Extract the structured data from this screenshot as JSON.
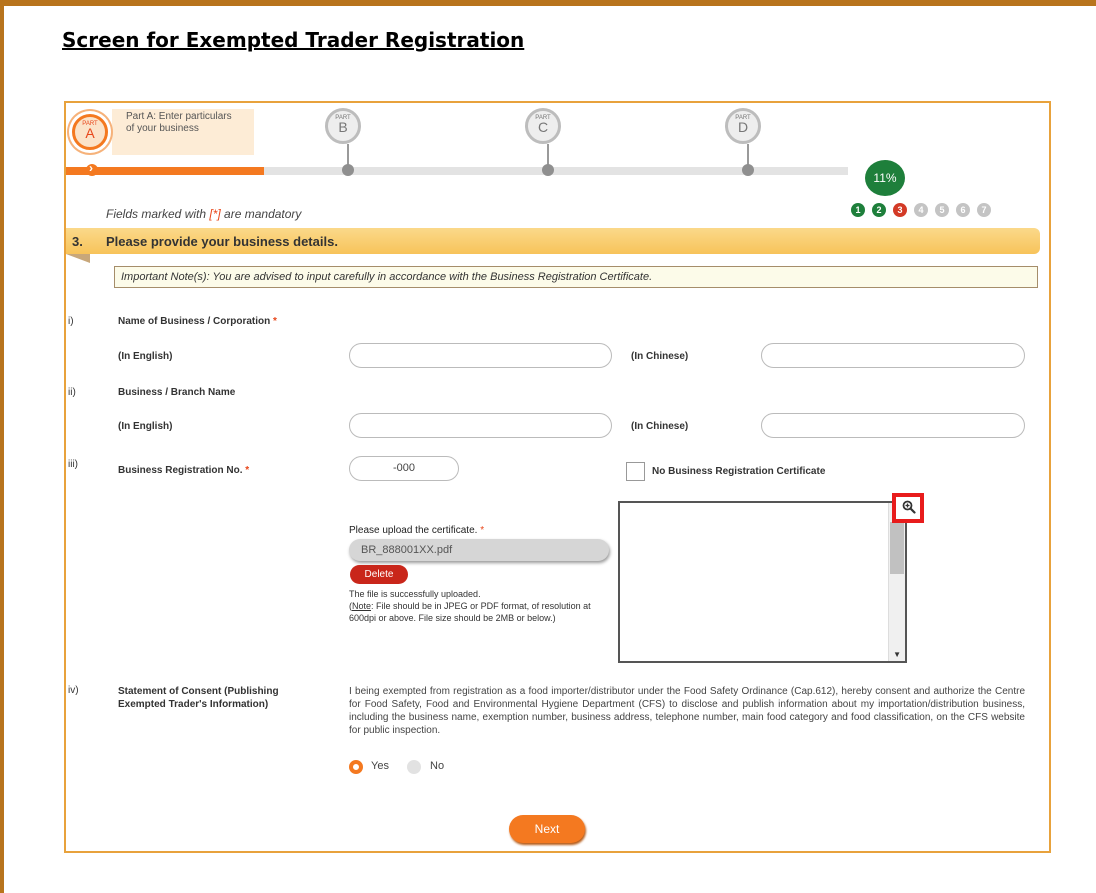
{
  "document_title": "Screen for Exempted Trader Registration",
  "progress": {
    "parts": [
      {
        "small": "PART",
        "letter": "A",
        "active": true
      },
      {
        "small": "PART",
        "letter": "B",
        "active": false
      },
      {
        "small": "PART",
        "letter": "C",
        "active": false
      },
      {
        "small": "PART",
        "letter": "D",
        "active": false
      }
    ],
    "active_part_description": "Part A: Enter particulars of your business",
    "percent_label": "11%",
    "percent_value": 0.11,
    "steps": [
      {
        "label": "1",
        "state": "done"
      },
      {
        "label": "2",
        "state": "done"
      },
      {
        "label": "3",
        "state": "current"
      },
      {
        "label": "4",
        "state": "pending"
      },
      {
        "label": "5",
        "state": "pending"
      },
      {
        "label": "6",
        "state": "pending"
      },
      {
        "label": "7",
        "state": "pending"
      }
    ]
  },
  "mandatory_note": {
    "prefix": "Fields marked with ",
    "star": "[*]",
    "suffix": " are mandatory"
  },
  "section": {
    "number": "3.",
    "title": "Please provide your business details."
  },
  "important_note": "Important Note(s): You are advised to input carefully in accordance with the Business Registration Certificate.",
  "questions": {
    "q1": {
      "roman": "i)",
      "label": "Name of Business / Corporation",
      "required_mark": "*",
      "english_label": "(In English)",
      "english_value": "",
      "chinese_label": "(In Chinese)",
      "chinese_value": ""
    },
    "q2": {
      "roman": "ii)",
      "label": "Business / Branch Name",
      "english_label": "(In English)",
      "english_value": "",
      "chinese_label": "(In Chinese)",
      "chinese_value": ""
    },
    "q3": {
      "roman": "iii)",
      "label": "Business Registration No.",
      "required_mark": "*",
      "br_value": "-000",
      "no_brc_label": "No Business Registration Certificate",
      "no_brc_checked": false
    },
    "upload": {
      "title": "Please upload the certificate.",
      "required_mark": "*",
      "file_name": "BR_888001XX.pdf",
      "delete_label": "Delete",
      "success_msg": "The file is successfully uploaded.",
      "note_label": "Note",
      "note_text": ": File should be in JPEG or PDF format, of resolution at 600dpi or above. File size should be 2MB or below.)",
      "note_open": "("
    },
    "q4": {
      "roman": "iv)",
      "label": "Statement of Consent (Publishing Exempted Trader's Information)",
      "consent_text": "I being exempted from registration as a food importer/distributor under the Food Safety Ordinance (Cap.612), hereby consent and authorize the Centre for Food Safety, Food and Environmental Hygiene Department (CFS) to disclose and publish information about my importation/distribution business, including the business name, exemption number, business address, telephone number, main food category and food classification, on the CFS website for public inspection.",
      "yes_label": "Yes",
      "no_label": "No",
      "selected": "Yes"
    }
  },
  "next_label": "Next",
  "colors": {
    "accent": "#f47920",
    "frame": "#e8a23c",
    "title_border": "#b8741d",
    "done_green": "#1e7f3b",
    "current_red": "#d33a26",
    "delete_red": "#c9261a",
    "highlight_red": "#e81c1c"
  },
  "icons": {
    "zoom": "zoom-in-magnifier-icon",
    "scroll_down": "triangle-down-icon"
  }
}
